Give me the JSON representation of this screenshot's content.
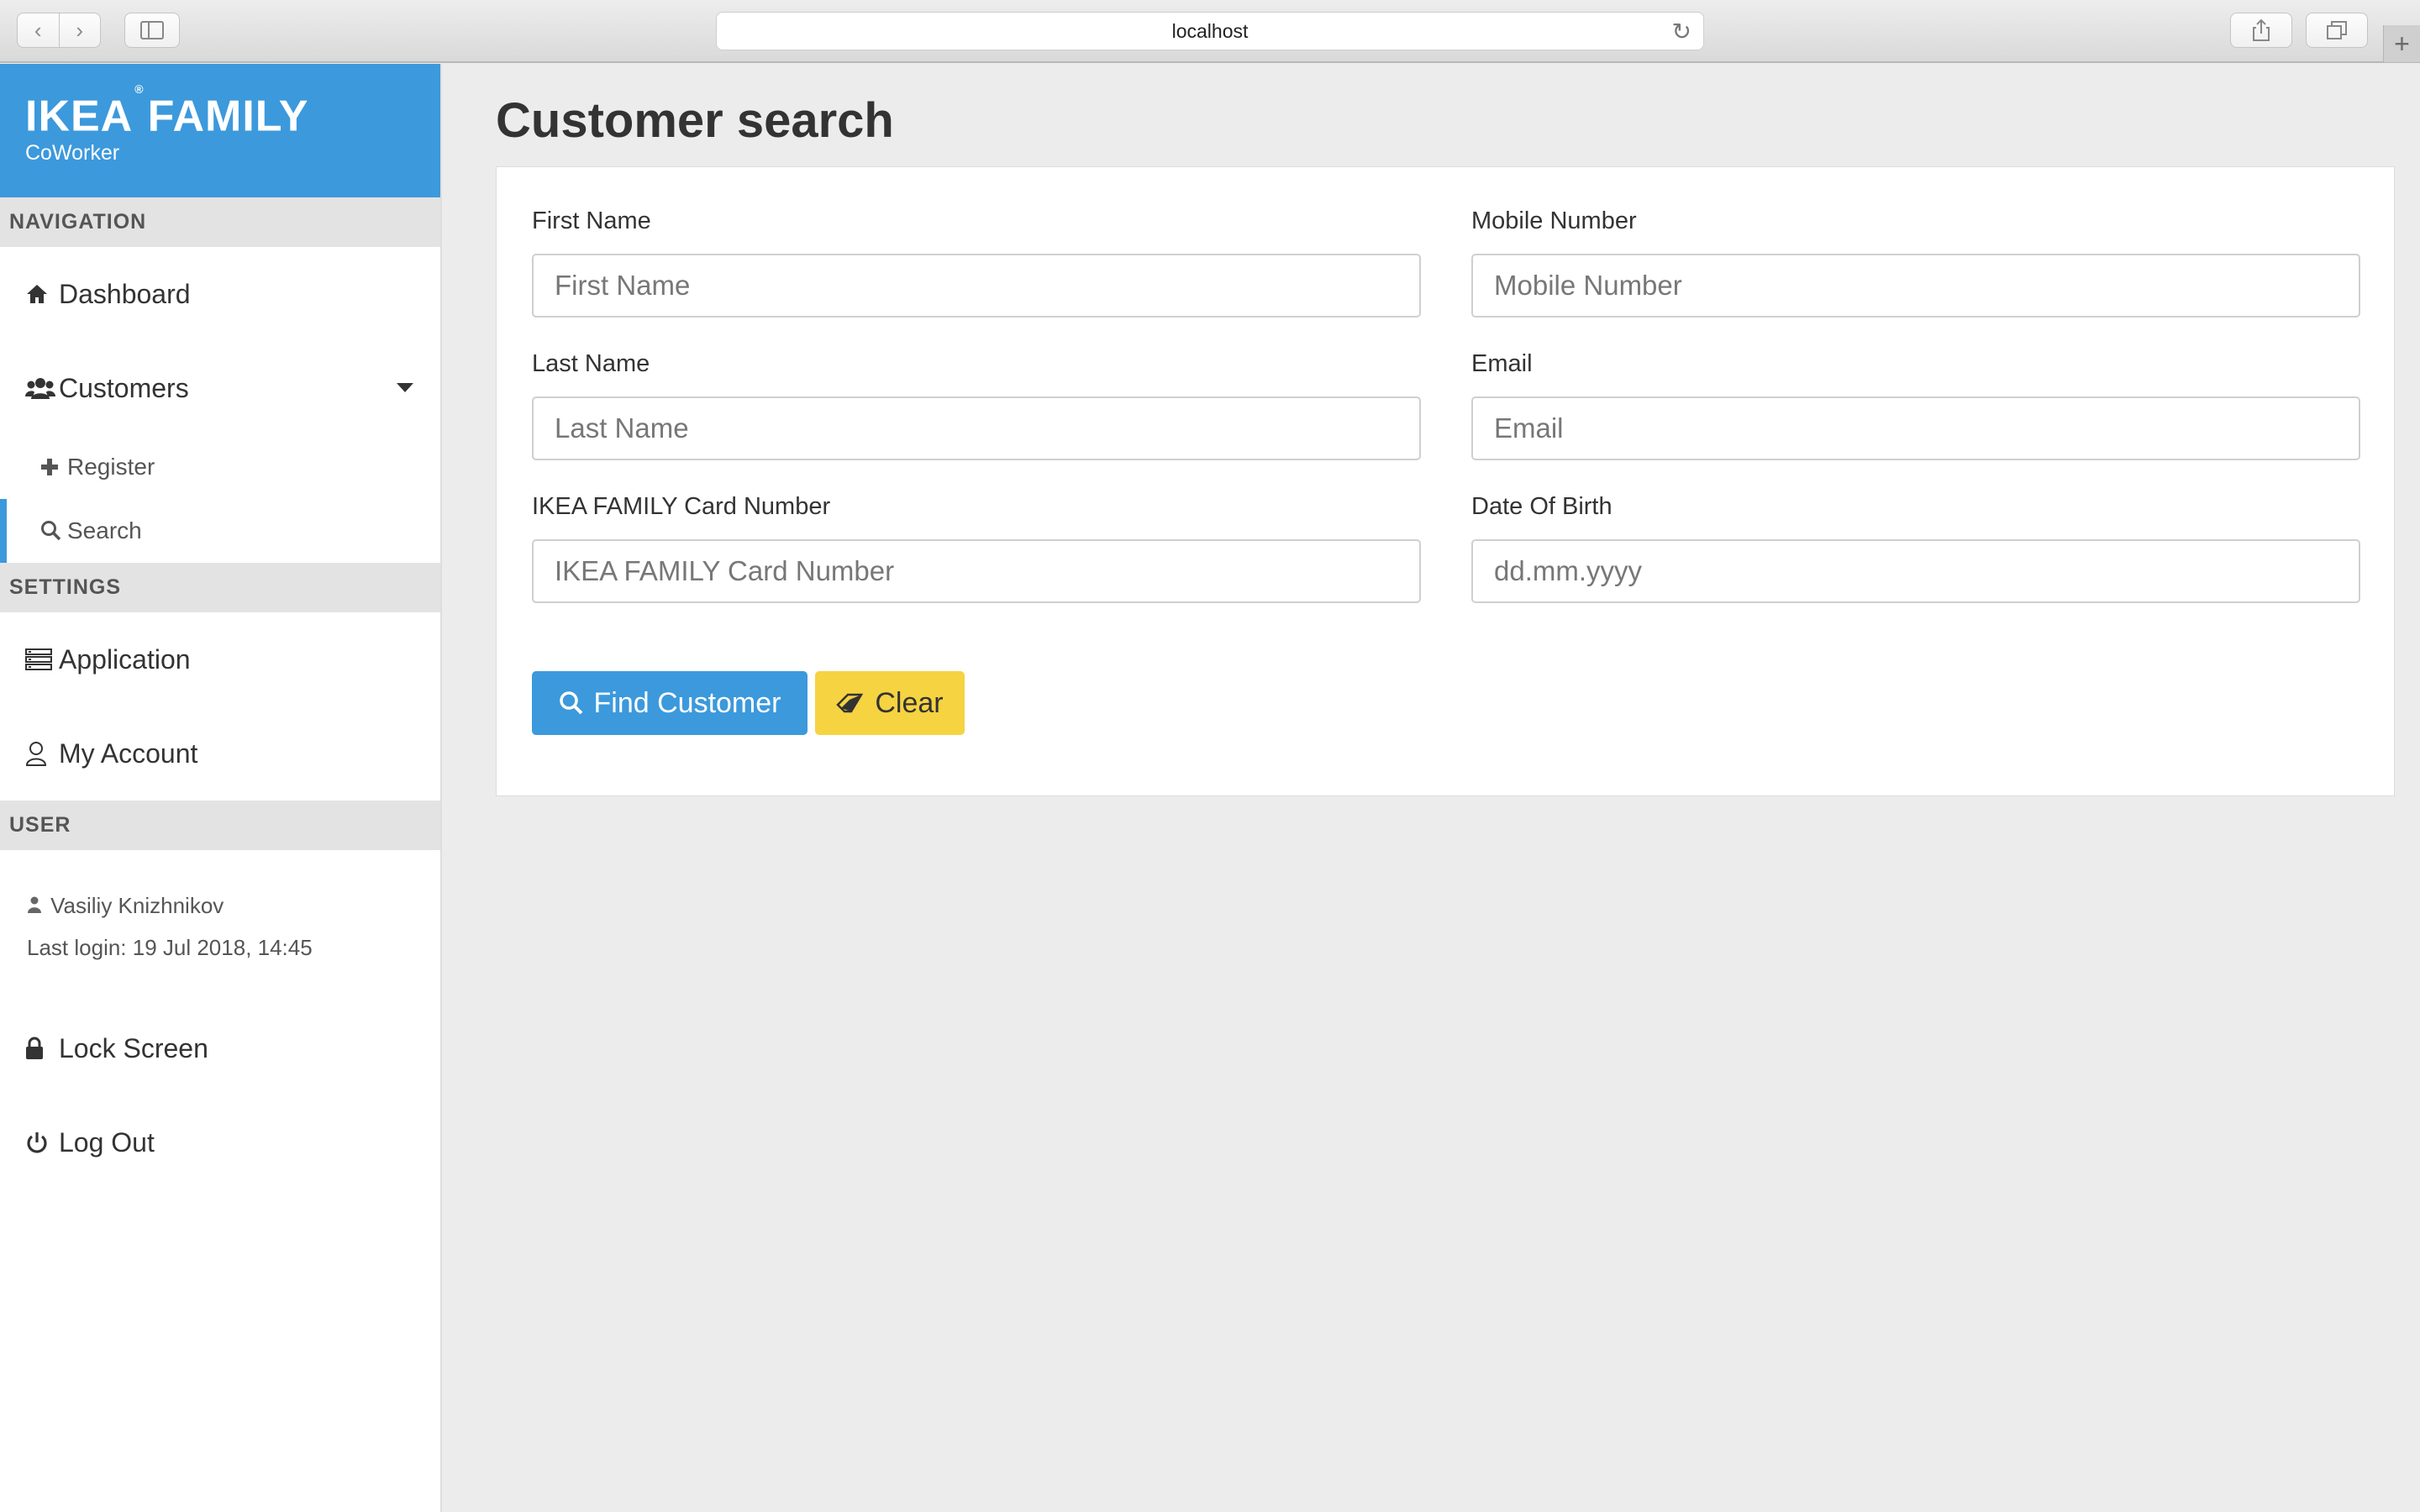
{
  "browser": {
    "address": "localhost",
    "back_icon": "‹",
    "forward_icon": "›",
    "reload_icon": "↻",
    "new_tab_icon": "+"
  },
  "brand": {
    "title_left": "IKEA",
    "title_mark": "®",
    "title_right": "FAMILY",
    "subtitle": "CoWorker",
    "color": "#3c99dc"
  },
  "sidebar": {
    "navigation_header": "NAVIGATION",
    "dashboard": "Dashboard",
    "customers": "Customers",
    "register": "Register",
    "search": "Search",
    "settings_header": "SETTINGS",
    "application": "Application",
    "my_account": "My Account",
    "user_header": "USER",
    "user_name": "Vasiliy Knizhnikov",
    "last_login": "Last login: 19 Jul 2018, 14:45",
    "lock_screen": "Lock Screen",
    "log_out": "Log Out"
  },
  "main": {
    "title": "Customer search",
    "fields": {
      "first_name_label": "First Name",
      "first_name_placeholder": "First Name",
      "mobile_label": "Mobile Number",
      "mobile_placeholder": "Mobile Number",
      "last_name_label": "Last Name",
      "last_name_placeholder": "Last Name",
      "email_label": "Email",
      "email_placeholder": "Email",
      "card_label": "IKEA FAMILY Card Number",
      "card_placeholder": "IKEA FAMILY Card Number",
      "dob_label": "Date Of Birth",
      "dob_placeholder": "dd.mm.yyyy"
    },
    "find_button": "Find Customer",
    "clear_button": "Clear"
  },
  "colors": {
    "accent": "#3c99dc",
    "clear_button": "#f6d341"
  }
}
